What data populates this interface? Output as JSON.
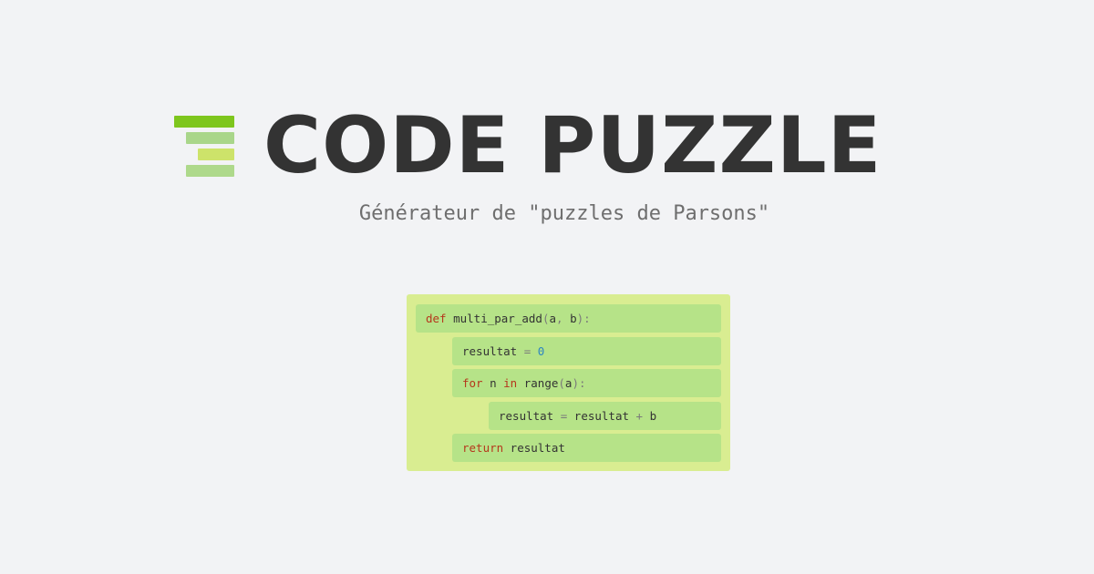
{
  "logo": {
    "bar_colors": [
      "#7ec61d",
      "#a9d68a",
      "#cde36a",
      "#aed98b"
    ]
  },
  "header": {
    "title": "CODE PUZZLE",
    "subtitle": "Générateur de \"puzzles de Parsons\""
  },
  "colors": {
    "background": "#f2f3f5",
    "panel": "#d9ed91",
    "block": "#b6e388",
    "title": "#333333",
    "keyword": "#b5371c",
    "number": "#2e86c1"
  },
  "puzzle": {
    "blocks": [
      {
        "indent": 0,
        "tokens": [
          {
            "t": "def",
            "k": "kw"
          },
          {
            "t": " multi_par_add",
            "k": "id"
          },
          {
            "t": "(",
            "k": "op"
          },
          {
            "t": "a",
            "k": "id"
          },
          {
            "t": ", ",
            "k": "op"
          },
          {
            "t": "b",
            "k": "id"
          },
          {
            "t": "):",
            "k": "op"
          }
        ]
      },
      {
        "indent": 1,
        "tokens": [
          {
            "t": "resultat",
            "k": "id"
          },
          {
            "t": " = ",
            "k": "op"
          },
          {
            "t": "0",
            "k": "num"
          }
        ]
      },
      {
        "indent": 1,
        "tokens": [
          {
            "t": "for",
            "k": "kw"
          },
          {
            "t": " n ",
            "k": "id"
          },
          {
            "t": "in",
            "k": "kw"
          },
          {
            "t": " range",
            "k": "id"
          },
          {
            "t": "(",
            "k": "op"
          },
          {
            "t": "a",
            "k": "id"
          },
          {
            "t": "):",
            "k": "op"
          }
        ]
      },
      {
        "indent": 2,
        "tokens": [
          {
            "t": "resultat",
            "k": "id"
          },
          {
            "t": " = ",
            "k": "op"
          },
          {
            "t": "resultat",
            "k": "id"
          },
          {
            "t": " + ",
            "k": "op"
          },
          {
            "t": "b",
            "k": "id"
          }
        ]
      },
      {
        "indent": 1,
        "tokens": [
          {
            "t": "return",
            "k": "kw"
          },
          {
            "t": " resultat",
            "k": "id"
          }
        ]
      }
    ]
  }
}
